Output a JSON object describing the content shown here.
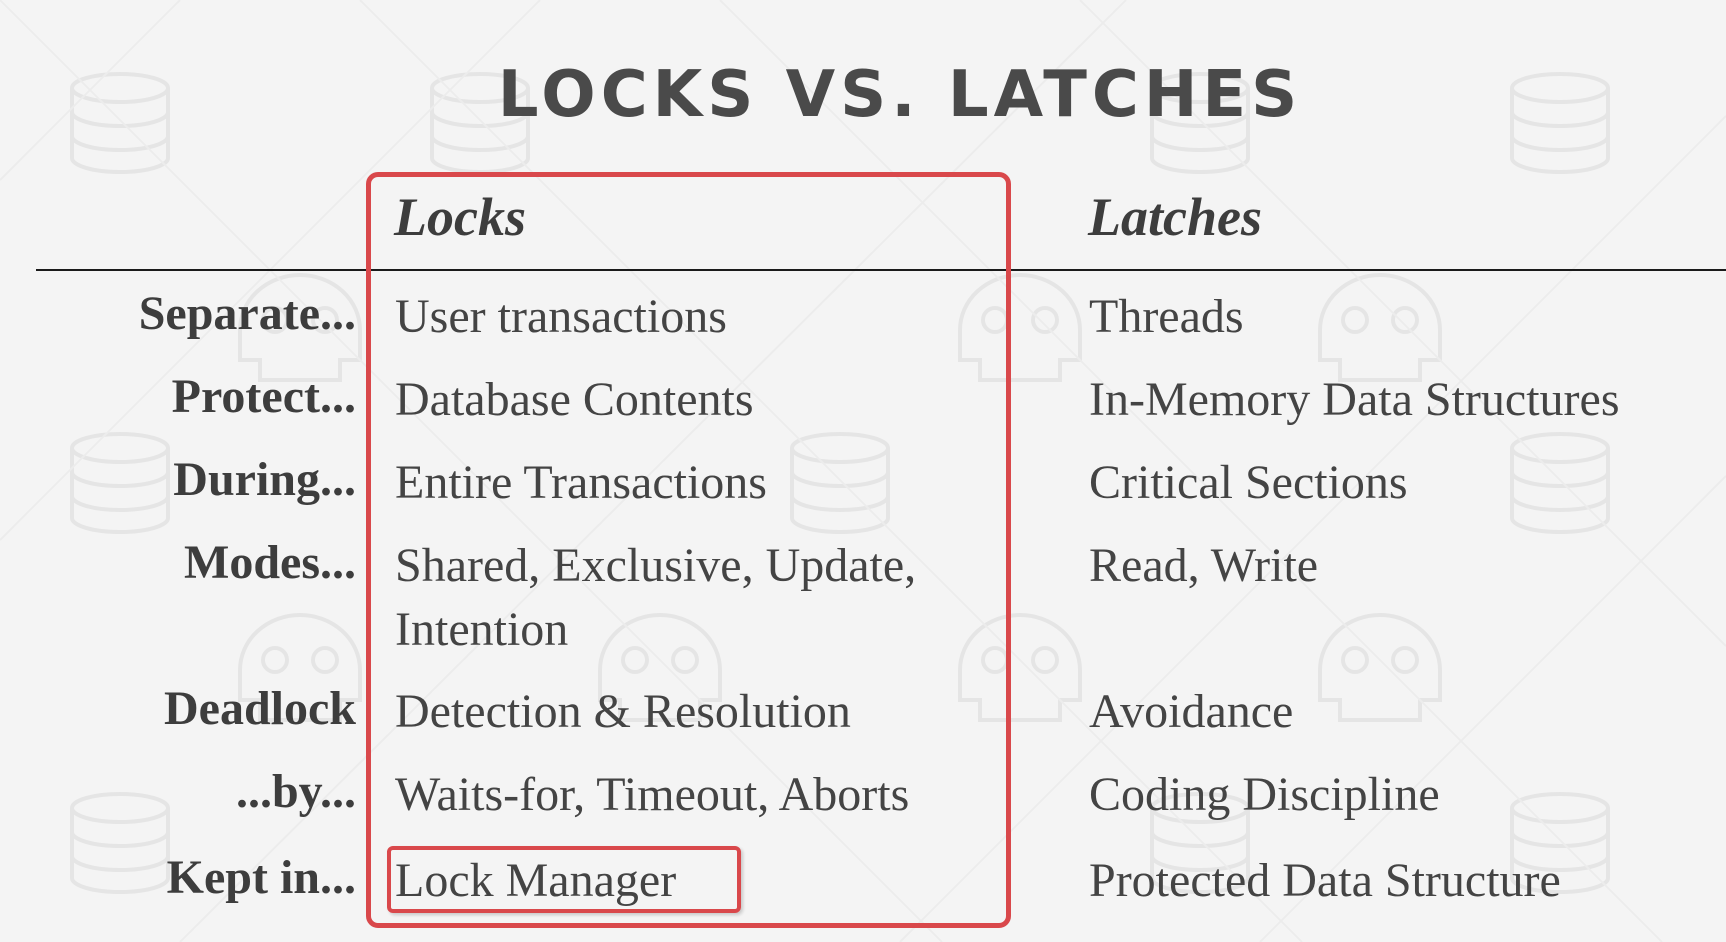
{
  "title": "LOCKS VS. LATCHES",
  "columns": {
    "locks": "Locks",
    "latches": "Latches"
  },
  "rows": [
    {
      "label": "Separate...",
      "locks": [
        "User transactions"
      ],
      "latches": "Threads"
    },
    {
      "label": "Protect...",
      "locks": [
        "Database Contents"
      ],
      "latches": "In-Memory Data Structures"
    },
    {
      "label": "During...",
      "locks": [
        "Entire Transactions"
      ],
      "latches": "Critical Sections"
    },
    {
      "label": "Modes...",
      "locks": [
        "Shared, Exclusive, Update,",
        "Intention"
      ],
      "latches": "Read, Write"
    },
    {
      "label": "Deadlock",
      "locks": [
        "Detection & Resolution"
      ],
      "latches": "Avoidance"
    },
    {
      "label": "...by...",
      "locks": [
        "Waits-for, Timeout, Aborts"
      ],
      "latches": "Coding Discipline"
    },
    {
      "label": "Kept in...",
      "locks": [
        "Lock Manager"
      ],
      "latches": "Protected Data Structure"
    }
  ],
  "highlight_color": "#d9484b"
}
